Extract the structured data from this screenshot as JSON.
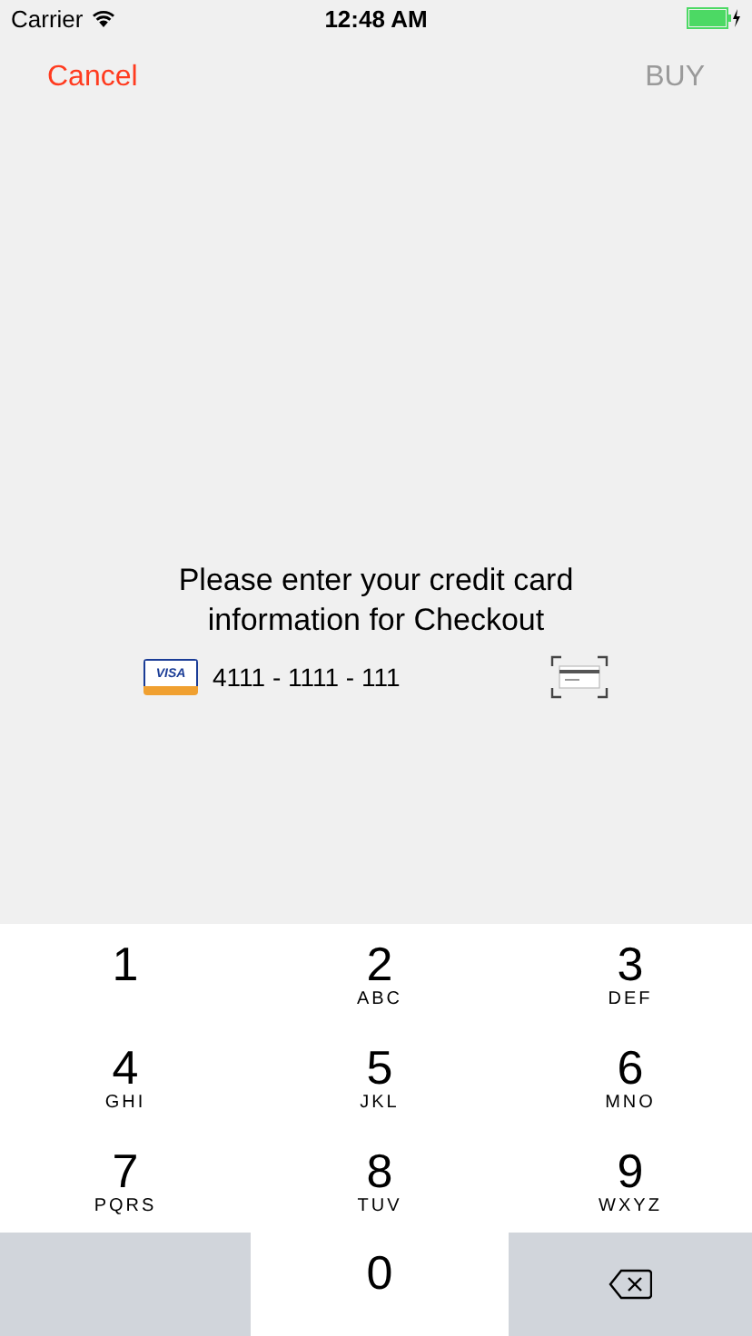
{
  "status_bar": {
    "carrier": "Carrier",
    "time": "12:48 AM",
    "charging": true
  },
  "nav": {
    "cancel": {
      "label": "Cancel",
      "disabled": false
    },
    "buy": {
      "label": "BUY",
      "disabled": true
    }
  },
  "prompt": "Please enter your credit card information for Checkout",
  "card": {
    "brand": "VISA",
    "number": "4111 - 1111 - 111"
  },
  "keypad": [
    {
      "kind": "digit",
      "digit": "1"
    },
    {
      "kind": "digit",
      "digit": "2",
      "letters": "ABC"
    },
    {
      "kind": "digit",
      "digit": "3",
      "letters": "DEF"
    },
    {
      "kind": "digit",
      "digit": "4",
      "letters": "GHI"
    },
    {
      "kind": "digit",
      "digit": "5",
      "letters": "JKL"
    },
    {
      "kind": "digit",
      "digit": "6",
      "letters": "MNO"
    },
    {
      "kind": "digit",
      "digit": "7",
      "letters": "PQRS"
    },
    {
      "kind": "digit",
      "digit": "8",
      "letters": "TUV"
    },
    {
      "kind": "digit",
      "digit": "9",
      "letters": "WXYZ"
    },
    {
      "kind": "blank"
    },
    {
      "kind": "digit",
      "digit": "0"
    },
    {
      "kind": "delete"
    }
  ]
}
